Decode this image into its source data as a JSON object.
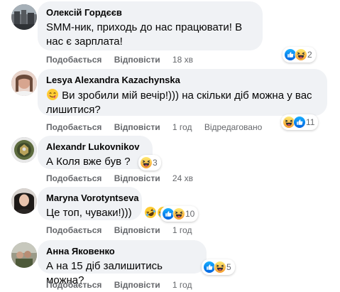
{
  "comments": [
    {
      "author": "Олексій Гордєєв",
      "text": "SMM-ник, приходь до нас працювати! В нас є зарплата!",
      "actions": {
        "like": "Подобається",
        "reply": "Відповісти",
        "time": "18 хв"
      },
      "reaction_count": "2",
      "reaction_icons": [
        "like-icon",
        "haha-icon"
      ]
    },
    {
      "author": "Lesya Alexandra Kazachynska",
      "text": "Ви зробили мій вечір!))) на скільки діб можна у вас лишитися?",
      "leading_emoji": "smiling-face-with-tongue-emoji",
      "actions": {
        "like": "Подобається",
        "reply": "Відповісти",
        "time": "1 год",
        "edited": "Відредаговано"
      },
      "reaction_count": "11",
      "reaction_icons": [
        "haha-icon",
        "like-icon"
      ]
    },
    {
      "author": "Alexandr Lukovnikov",
      "text": "А Коля вже був ?",
      "actions": {
        "like": "Подобається",
        "reply": "Відповісти",
        "time": "24 хв"
      },
      "reaction_count": "3",
      "reaction_icons": [
        "haha-icon"
      ]
    },
    {
      "author": "Maryna Vorotyntseva",
      "text": "Це топ, чуваки!)))",
      "trailing_emojis": [
        "rolling-on-floor-laughing-emoji",
        "rolling-on-floor-laughing-emoji"
      ],
      "actions": {
        "like": "Подобається",
        "reply": "Відповісти",
        "time": "1 год"
      },
      "reaction_count": "10",
      "reaction_icons": [
        "like-icon",
        "haha-icon"
      ]
    },
    {
      "author": "Анна Яковенко",
      "text": "А на 15 діб залишитись можна?",
      "actions": {
        "like": "Подобається",
        "reply": "Відповісти",
        "time": "1 год"
      },
      "reaction_count": "5",
      "reaction_icons": [
        "like-icon",
        "haha-icon"
      ]
    }
  ],
  "colors": {
    "bubble_bg": "#f0f2f5",
    "meta_text": "#65676b",
    "like_blue": "#1877f2",
    "haha_yellow": "#f7b928"
  }
}
